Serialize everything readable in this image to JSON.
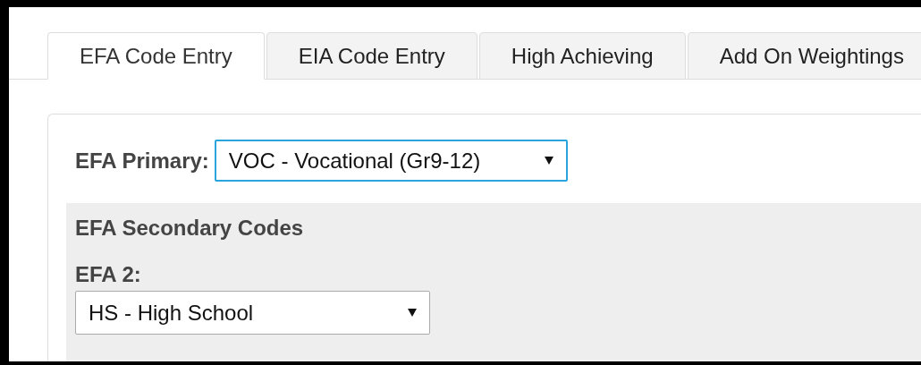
{
  "tabs": [
    {
      "label": "EFA Code Entry",
      "selected": true
    },
    {
      "label": "EIA Code Entry",
      "selected": false
    },
    {
      "label": "High Achieving",
      "selected": false
    },
    {
      "label": "Add On Weightings",
      "selected": false
    }
  ],
  "primary": {
    "label": "EFA Primary:",
    "value": "VOC - Vocational (Gr9-12)",
    "focused": true
  },
  "secondary": {
    "title": "EFA Secondary Codes",
    "fields": [
      {
        "label": "EFA 2:",
        "value": "HS - High School",
        "focused": false
      }
    ]
  }
}
